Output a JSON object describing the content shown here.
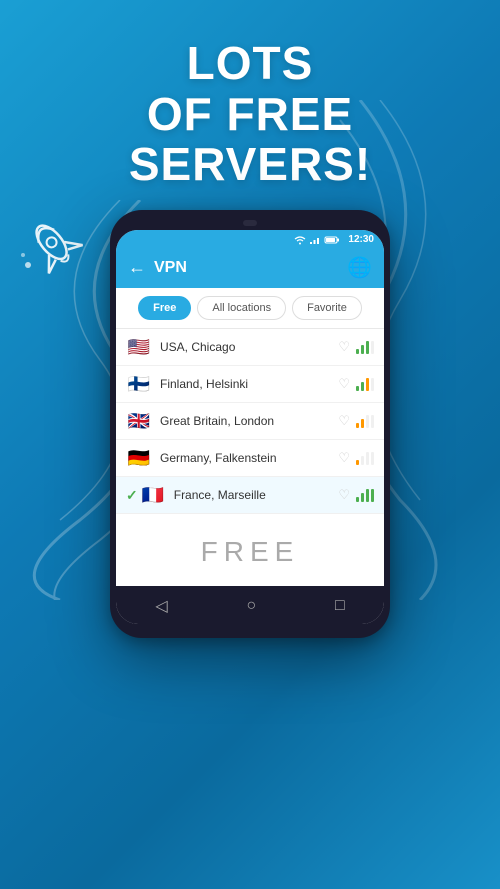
{
  "background": {
    "gradient_start": "#1a9fd4",
    "gradient_end": "#0a6a9e"
  },
  "header": {
    "line1": "Lots",
    "line2": "of free",
    "line3": "servers!"
  },
  "status_bar": {
    "time": "12:30"
  },
  "app_bar": {
    "title": "VPN",
    "back_icon": "back-arrow-icon",
    "globe_icon": "globe-icon"
  },
  "tabs": [
    {
      "label": "Free",
      "active": true
    },
    {
      "label": "All locations",
      "active": false
    },
    {
      "label": "Favorite",
      "active": false
    }
  ],
  "servers": [
    {
      "flag": "🇺🇸",
      "name": "USA, Chicago",
      "signal": [
        4,
        4,
        3
      ],
      "liked": false,
      "selected": false,
      "id": "usa-chicago"
    },
    {
      "flag": "🇫🇮",
      "name": "Finland, Helsinki",
      "signal": [
        4,
        3,
        2
      ],
      "liked": false,
      "selected": false,
      "id": "finland-helsinki"
    },
    {
      "flag": "🇬🇧",
      "name": "Great Britain, London",
      "signal": [
        3,
        3,
        2
      ],
      "liked": false,
      "selected": false,
      "id": "gb-london"
    },
    {
      "flag": "🇩🇪",
      "name": "Germany, Falkenstein",
      "signal": [
        3,
        2,
        1
      ],
      "liked": false,
      "selected": false,
      "id": "germany-falkenstein"
    },
    {
      "flag": "🇫🇷",
      "name": "France, Marseille",
      "signal": [
        4,
        4,
        4
      ],
      "liked": false,
      "selected": true,
      "id": "france-marseille"
    }
  ],
  "free_label": "FREE",
  "nav_buttons": [
    {
      "icon": "◁",
      "name": "back-nav-icon"
    },
    {
      "icon": "○",
      "name": "home-nav-icon"
    },
    {
      "icon": "□",
      "name": "recent-nav-icon"
    }
  ]
}
